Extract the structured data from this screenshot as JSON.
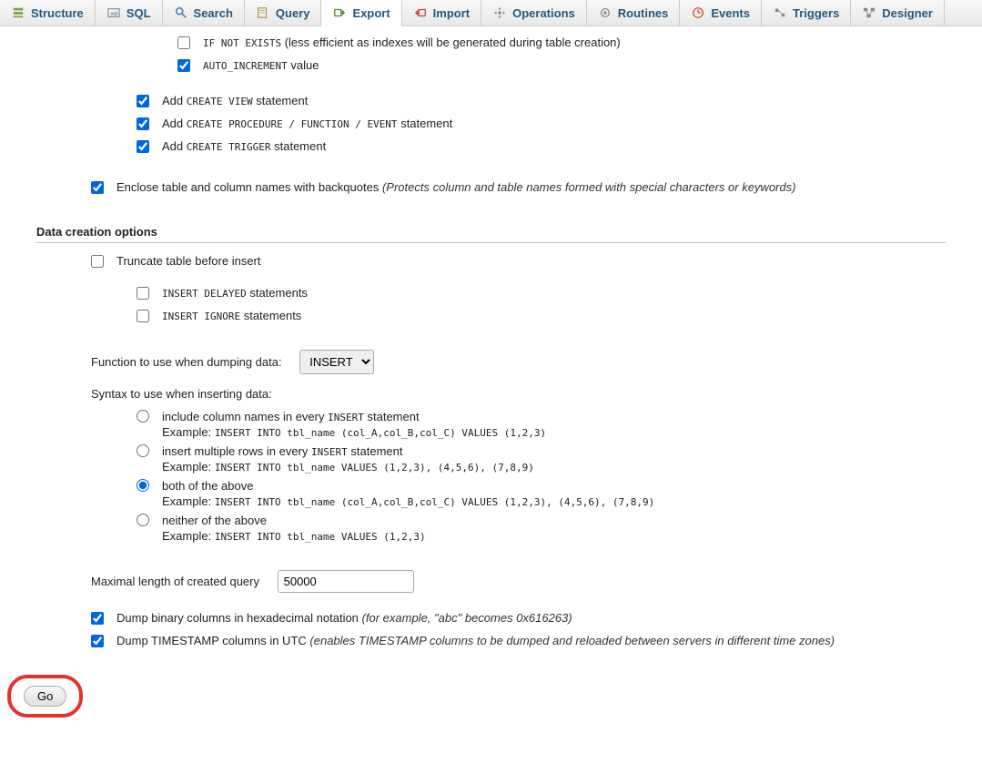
{
  "tabs": {
    "structure": "Structure",
    "sql": "SQL",
    "search": "Search",
    "query": "Query",
    "export": "Export",
    "import": "Import",
    "operations": "Operations",
    "routines": "Routines",
    "events": "Events",
    "triggers": "Triggers",
    "designer": "Designer"
  },
  "opt": {
    "if_not_exists_code": "IF NOT EXISTS",
    "if_not_exists_text": "(less efficient as indexes will be generated during table creation)",
    "auto_increment_code": "AUTO_INCREMENT",
    "auto_increment_text": "value",
    "add": "Add",
    "create_view": "CREATE VIEW",
    "create_proc": "CREATE PROCEDURE / FUNCTION / EVENT",
    "create_trigger": "CREATE TRIGGER",
    "statement": "statement",
    "enclose": "Enclose table and column names with backquotes",
    "enclose_note": "(Protects column and table names formed with special characters or keywords)"
  },
  "data_section": {
    "title": "Data creation options",
    "truncate": "Truncate table before insert",
    "ins_delayed_code": "INSERT DELAYED",
    "ins_ignore_code": "INSERT IGNORE",
    "statements": "statements",
    "func_label": "Function to use when dumping data:",
    "func_value": "INSERT",
    "syntax_label": "Syntax to use when inserting data:",
    "r1_text_a": "include column names in every",
    "r1_code": "INSERT",
    "r1_text_b": "statement",
    "r1_example": "INSERT INTO tbl_name (col_A,col_B,col_C) VALUES (1,2,3)",
    "r2_text_a": "insert multiple rows in every",
    "r2_code": "INSERT",
    "r2_text_b": "statement",
    "r2_example": "INSERT INTO tbl_name VALUES (1,2,3), (4,5,6), (7,8,9)",
    "r3_text": "both of the above",
    "r3_example": "INSERT INTO tbl_name (col_A,col_B,col_C) VALUES (1,2,3), (4,5,6), (7,8,9)",
    "r4_text": "neither of the above",
    "r4_example": "INSERT INTO tbl_name VALUES (1,2,3)",
    "example_label": "Example:",
    "maxlen_label": "Maximal length of created query",
    "maxlen_value": "50000",
    "hex_label": "Dump binary columns in hexadecimal notation",
    "hex_note": "(for example, \"abc\" becomes 0x616263)",
    "utc_label": "Dump TIMESTAMP columns in UTC",
    "utc_note": "(enables TIMESTAMP columns to be dumped and reloaded between servers in different time zones)"
  },
  "go": "Go"
}
